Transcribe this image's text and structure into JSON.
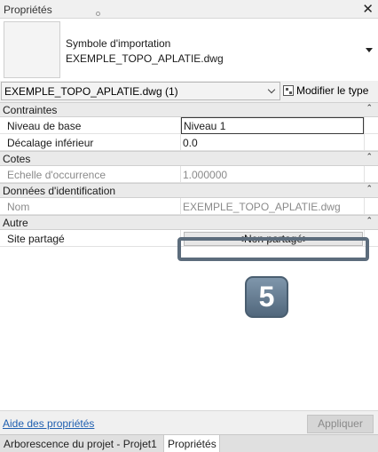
{
  "window": {
    "title": "Propriétés"
  },
  "type_selector": {
    "category": "Symbole d'importation",
    "type_name": "EXEMPLE_TOPO_APLATIE.dwg"
  },
  "instance_filter": {
    "value": "EXEMPLE_TOPO_APLATIE.dwg (1)",
    "modify_type_label": "Modifier le type"
  },
  "groups": [
    {
      "name": "Contraintes",
      "rows": [
        {
          "label": "Niveau de base",
          "value": "Niveau 1"
        },
        {
          "label": "Décalage inférieur",
          "value": "0.0"
        }
      ]
    },
    {
      "name": "Cotes",
      "rows": [
        {
          "label": "Echelle d'occurrence",
          "value": "1.000000"
        }
      ]
    },
    {
      "name": "Données d'identification",
      "rows": [
        {
          "label": "Nom",
          "value": "EXEMPLE_TOPO_APLATIE.dwg"
        }
      ]
    },
    {
      "name": "Autre",
      "rows": [
        {
          "label": "Site partagé",
          "value": "<Non partagé>"
        }
      ]
    }
  ],
  "collapse_glyph": "⌃",
  "callout_badge": "5",
  "footer": {
    "help_link": "Aide des propriétés",
    "apply_label": "Appliquer"
  },
  "tabs": [
    {
      "label": "Arborescence du projet - Projet1"
    },
    {
      "label": "Propriétés"
    }
  ],
  "colors": {
    "link": "#1f5fb0",
    "highlight_frame": "#5c6c7c",
    "badge": "#6b8298"
  }
}
